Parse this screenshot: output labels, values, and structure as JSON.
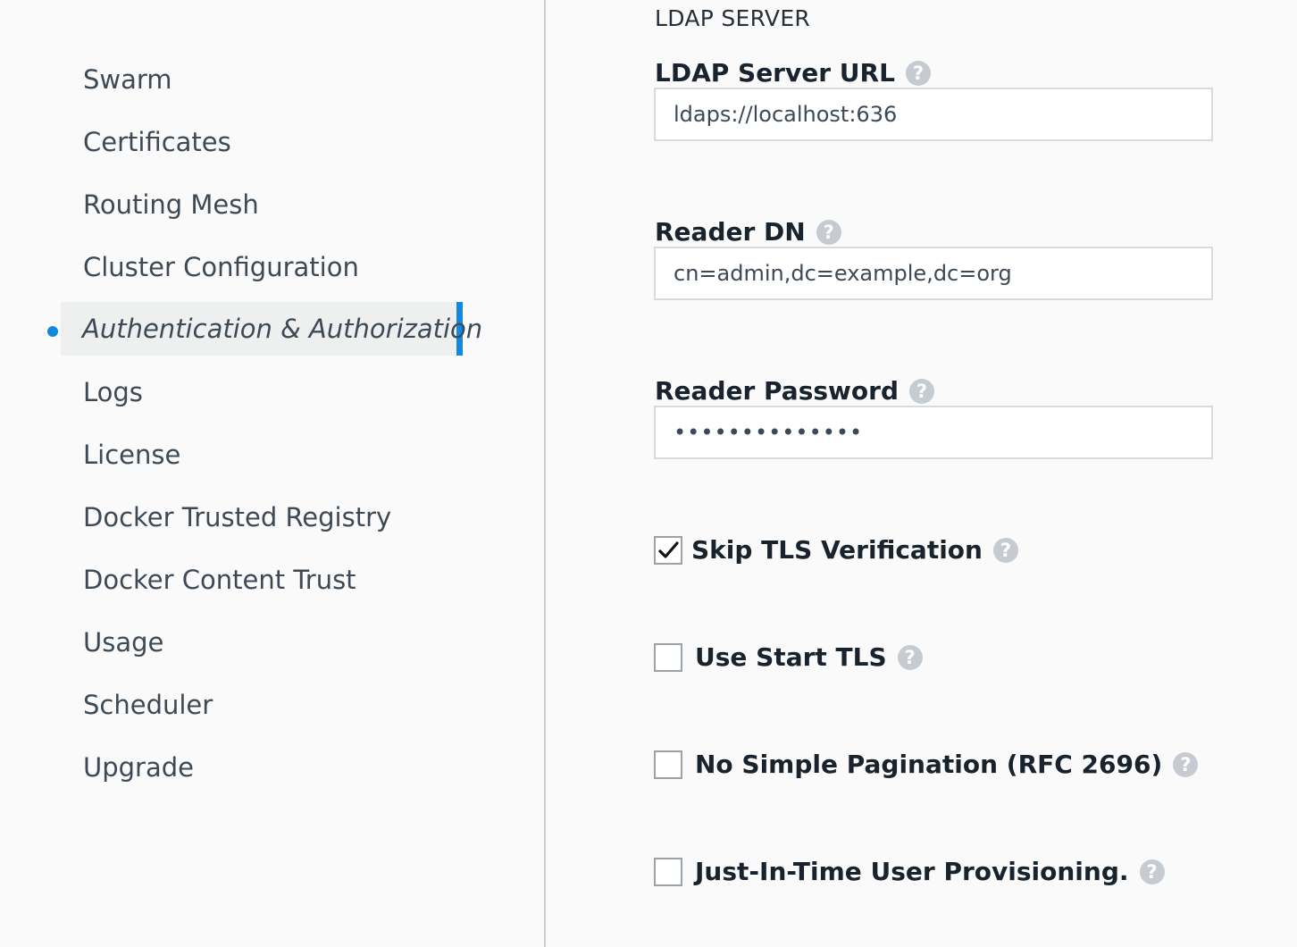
{
  "sidebar": {
    "items": [
      {
        "label": "Swarm"
      },
      {
        "label": "Certificates"
      },
      {
        "label": "Routing Mesh"
      },
      {
        "label": "Cluster Configuration"
      },
      {
        "label": "Authentication & Authorization",
        "active": true
      },
      {
        "label": "Logs"
      },
      {
        "label": "License"
      },
      {
        "label": "Docker Trusted Registry"
      },
      {
        "label": "Docker Content Trust"
      },
      {
        "label": "Usage"
      },
      {
        "label": "Scheduler"
      },
      {
        "label": "Upgrade"
      }
    ]
  },
  "main": {
    "section_title": "LDAP SERVER",
    "fields": {
      "server_url": {
        "label": "LDAP Server URL",
        "value": "ldaps://localhost:636"
      },
      "reader_dn": {
        "label": "Reader DN",
        "value": "cn=admin,dc=example,dc=org"
      },
      "reader_password": {
        "label": "Reader Password",
        "value": "••••••••••••••"
      }
    },
    "options": {
      "skip_tls": {
        "label": "Skip TLS Verification",
        "checked": true
      },
      "start_tls": {
        "label": "Use Start TLS",
        "checked": false
      },
      "no_pagination": {
        "label": "No Simple Pagination (RFC 2696)",
        "checked": false
      },
      "jit_provisioning": {
        "label": "Just-In-Time User Provisioning.",
        "checked": false
      }
    },
    "help_glyph": "?"
  },
  "colors": {
    "accent": "#1488df",
    "help_icon": "#c5cbd0",
    "active_bg": "#eef0f0"
  },
  "icons": {
    "help": "help-icon",
    "check": "checkmark-icon",
    "active_indicator": "active-dot-icon"
  }
}
